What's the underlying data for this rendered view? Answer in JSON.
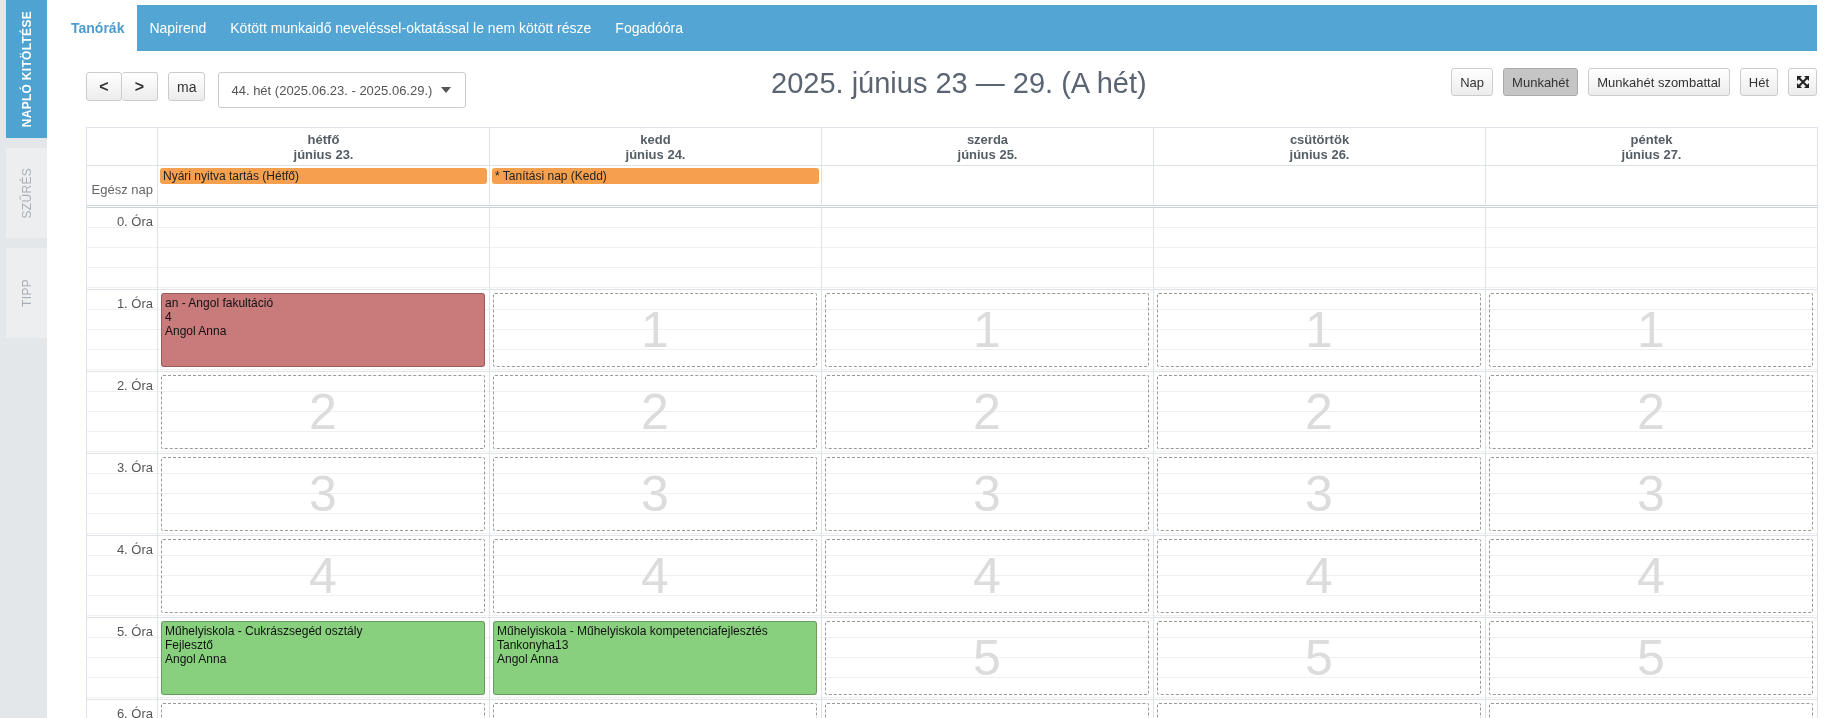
{
  "sidebar": {
    "tabs": [
      {
        "label": "NAPLÓ KITÖLTÉSE",
        "selected": true
      },
      {
        "label": "SZŰRÉS",
        "selected": false
      },
      {
        "label": "TIPP",
        "selected": false
      }
    ]
  },
  "tabs": [
    {
      "label": "Tanórák",
      "selected": true
    },
    {
      "label": "Napirend",
      "selected": false
    },
    {
      "label": "Kötött munkaidő neveléssel-oktatással le nem kötött része",
      "selected": false
    },
    {
      "label": "Fogadóóra",
      "selected": false
    }
  ],
  "toolbar": {
    "prev": "<",
    "next": ">",
    "today": "ma",
    "week_select": "44. hét (2025.06.23. - 2025.06.29.)",
    "title": "2025. június 23 — 29. (A hét)",
    "views": [
      {
        "label": "Nap",
        "selected": false
      },
      {
        "label": "Munkahét",
        "selected": true
      },
      {
        "label": "Munkahét szombattal",
        "selected": false
      },
      {
        "label": "Hét",
        "selected": false
      }
    ]
  },
  "calendar": {
    "all_day_label": "Egész nap",
    "days": [
      {
        "name": "hétfő",
        "date": "június 23.",
        "all_day_events": [
          {
            "text": "Nyári nyitva tartás (Hétfő)",
            "color": "#f5a04e"
          }
        ]
      },
      {
        "name": "kedd",
        "date": "június 24.",
        "all_day_events": [
          {
            "text": "* Tanítási nap (Kedd)",
            "color": "#f5a04e"
          }
        ]
      },
      {
        "name": "szerda",
        "date": "június 25."
      },
      {
        "name": "csütörtök",
        "date": "június 26."
      },
      {
        "name": "péntek",
        "date": "június 27."
      }
    ],
    "hours": [
      {
        "label": "0. Óra"
      },
      {
        "label": "1. Óra",
        "slots": [
          {
            "kind": "lesson",
            "color": "#c97b7b",
            "lines": [
              "an - Angol fakultáció",
              "4",
              "Angol Anna"
            ]
          },
          {
            "kind": "free",
            "number": "1"
          },
          {
            "kind": "free",
            "number": "1"
          },
          {
            "kind": "free",
            "number": "1"
          },
          {
            "kind": "free",
            "number": "1"
          }
        ]
      },
      {
        "label": "2. Óra",
        "slots": [
          {
            "kind": "free",
            "number": "2"
          },
          {
            "kind": "free",
            "number": "2"
          },
          {
            "kind": "free",
            "number": "2"
          },
          {
            "kind": "free",
            "number": "2"
          },
          {
            "kind": "free",
            "number": "2"
          }
        ]
      },
      {
        "label": "3. Óra",
        "slots": [
          {
            "kind": "free",
            "number": "3"
          },
          {
            "kind": "free",
            "number": "3"
          },
          {
            "kind": "free",
            "number": "3"
          },
          {
            "kind": "free",
            "number": "3"
          },
          {
            "kind": "free",
            "number": "3"
          }
        ]
      },
      {
        "label": "4. Óra",
        "slots": [
          {
            "kind": "free",
            "number": "4"
          },
          {
            "kind": "free",
            "number": "4"
          },
          {
            "kind": "free",
            "number": "4"
          },
          {
            "kind": "free",
            "number": "4"
          },
          {
            "kind": "free",
            "number": "4"
          }
        ]
      },
      {
        "label": "5. Óra",
        "slots": [
          {
            "kind": "lesson",
            "color": "#88d07e",
            "lines": [
              "Műhelyiskola - Cukrászsegéd osztály",
              "Fejlesztő",
              "Angol Anna"
            ]
          },
          {
            "kind": "lesson",
            "color": "#88d07e",
            "lines": [
              "Műhelyiskola - Műhelyiskola kompetenciafejlesztés",
              "Tankonyha13",
              "Angol Anna"
            ]
          },
          {
            "kind": "free",
            "number": "5"
          },
          {
            "kind": "free",
            "number": "5"
          },
          {
            "kind": "free",
            "number": "5"
          }
        ]
      },
      {
        "label": "6. Óra",
        "slots": [
          {
            "kind": "free"
          },
          {
            "kind": "free"
          },
          {
            "kind": "free"
          },
          {
            "kind": "free"
          },
          {
            "kind": "free"
          }
        ]
      }
    ]
  }
}
